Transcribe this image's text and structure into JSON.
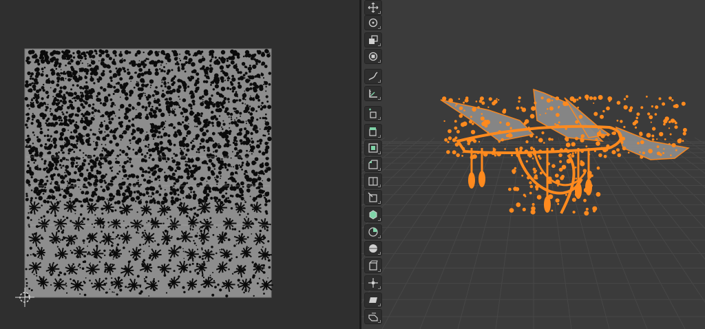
{
  "window": {
    "left_panel": "uv-editor",
    "right_panel": "3d-viewport"
  },
  "colors": {
    "background": "#2b2b2b",
    "uv_background": "#2f2f2f",
    "uv_square": "#8d8d8d",
    "uv_islands": "#0b0b0b",
    "viewport_background": "#3b3b3b",
    "grid_line": "#474747",
    "selection_orange": "#ff8a1e",
    "toolbar_button": "#2e2e2e",
    "icon_light": "#d0d0d0",
    "icon_accent": "#7fd3a8"
  },
  "toolbar": {
    "tools": [
      {
        "name": "move-icon",
        "group": "transform"
      },
      {
        "name": "rotate-icon",
        "group": "transform"
      },
      {
        "name": "scale-icon",
        "group": "transform"
      },
      {
        "name": "transform-icon",
        "group": "transform"
      },
      {
        "name": "annotate-icon",
        "group": "annotate"
      },
      {
        "name": "measure-icon",
        "group": "annotate"
      },
      {
        "name": "add-cube-icon",
        "group": "add"
      },
      {
        "name": "extrude-region-icon",
        "group": "edit"
      },
      {
        "name": "inset-faces-icon",
        "group": "edit"
      },
      {
        "name": "bevel-icon",
        "group": "edit"
      },
      {
        "name": "loop-cut-icon",
        "group": "edit"
      },
      {
        "name": "knife-icon",
        "group": "edit"
      },
      {
        "name": "poly-build-icon",
        "group": "edit"
      },
      {
        "name": "spin-icon",
        "group": "edit"
      },
      {
        "name": "smooth-icon",
        "group": "edit"
      },
      {
        "name": "edge-slide-icon",
        "group": "edit"
      },
      {
        "name": "shrink-fatten-icon",
        "group": "edit"
      },
      {
        "name": "shear-icon",
        "group": "edit"
      },
      {
        "name": "rip-region-icon",
        "group": "edit"
      }
    ]
  },
  "uv_editor": {
    "cursor_icon": "2d-cursor-icon"
  }
}
